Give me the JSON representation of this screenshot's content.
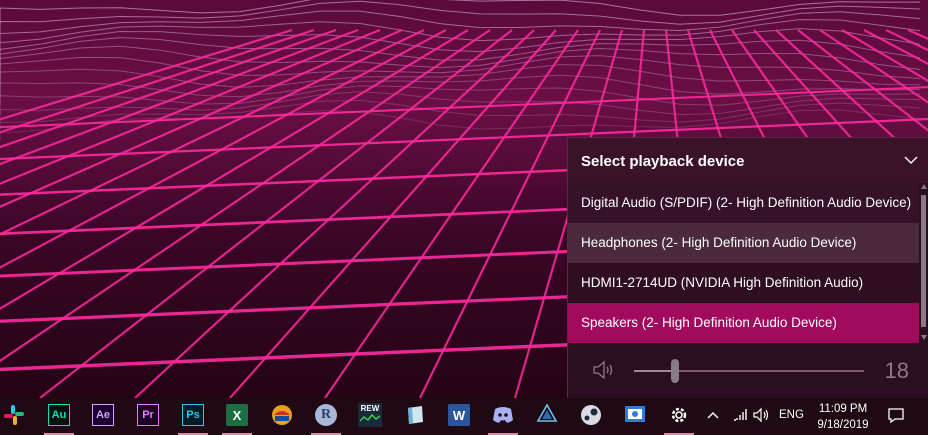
{
  "flyout": {
    "title": "Select playback device",
    "devices": [
      {
        "label": "Digital Audio (S/PDIF) (2- High Definition Audio Device)"
      },
      {
        "label": "Headphones (2- High Definition Audio Device)"
      },
      {
        "label": "HDMI1-2714UD (NVIDIA High Definition Audio)"
      },
      {
        "label": "Speakers (2- High Definition Audio Device)"
      }
    ],
    "selected_index": 3,
    "volume": {
      "value": "18",
      "level": 0.18
    }
  },
  "taskbar": {
    "apps": [
      {
        "name": "slack",
        "label": ""
      },
      {
        "name": "audition",
        "label": "Au",
        "color": "#00e4bb",
        "bg": "#00100c"
      },
      {
        "name": "after-effects",
        "label": "Ae",
        "color": "#d8a1ff",
        "bg": "#1c0030"
      },
      {
        "name": "premiere",
        "label": "Pr",
        "color": "#e77bff",
        "bg": "#1d0026"
      },
      {
        "name": "photoshop",
        "label": "Ps",
        "color": "#31c5f0",
        "bg": "#001d26"
      },
      {
        "name": "excel",
        "label": "X",
        "color": "#ffffff",
        "bg": "#1d6f42"
      },
      {
        "name": "app7",
        "label": ""
      },
      {
        "name": "r",
        "label": "R"
      },
      {
        "name": "rew",
        "label": "REW"
      },
      {
        "name": "app10",
        "label": ""
      },
      {
        "name": "word",
        "label": "W",
        "color": "#ffffff",
        "bg": "#2b579a"
      },
      {
        "name": "discord",
        "label": ""
      },
      {
        "name": "app13",
        "label": ""
      },
      {
        "name": "steam",
        "label": ""
      },
      {
        "name": "app15",
        "label": ""
      },
      {
        "name": "settings",
        "label": ""
      }
    ],
    "language": "ENG",
    "time": "11:09 PM",
    "date": "9/18/2019"
  }
}
